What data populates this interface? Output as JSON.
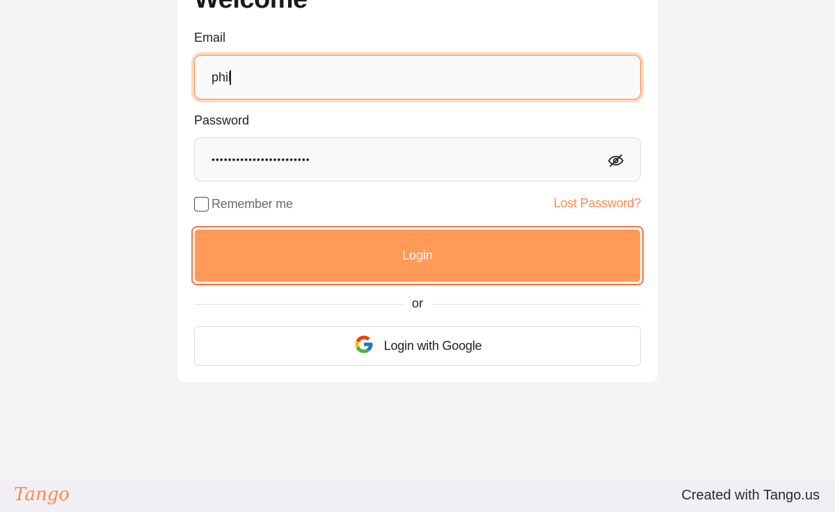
{
  "card": {
    "title": "Welcome"
  },
  "form": {
    "email_label": "Email",
    "email_value": "phil",
    "password_label": "Password",
    "password_value": "••••••••••••••••••••••••",
    "remember_label": "Remember me",
    "lost_password": "Lost Password?",
    "login_label": "Login",
    "divider_text": "or",
    "google_label": "Login with Google"
  },
  "footer": {
    "logo_text": "Tango",
    "created_text": "Created with Tango.us"
  },
  "colors": {
    "accent": "#ff9a57",
    "accent_border": "#ff6f3c",
    "link": "#ff8a4c"
  },
  "icons": {
    "password_toggle": "eye-slash-icon",
    "google": "google-icon"
  }
}
